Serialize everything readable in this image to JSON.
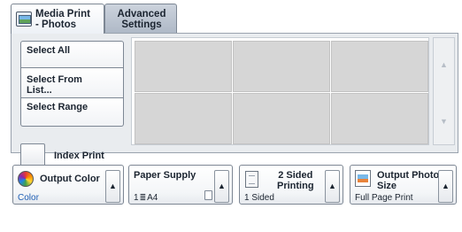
{
  "tabs": [
    {
      "label": "Media Print - Photos",
      "line1": "Media Print",
      "line2": "- Photos",
      "active": true
    },
    {
      "label": "Advanced Settings",
      "line1": "Advanced",
      "line2": "Settings",
      "active": false
    }
  ],
  "selection": {
    "select_all": "Select All",
    "select_from_list_1": "Select From",
    "select_from_list_2": "List...",
    "select_range": "Select Range",
    "index_print": "Index Print"
  },
  "thumbnails": {
    "rows": 2,
    "cols": 3
  },
  "bottom": {
    "output_color": {
      "title": "Output Color",
      "value": "Color",
      "value_color": "#1f5fb5"
    },
    "paper_supply": {
      "title": "Paper Supply",
      "value": "A4",
      "tray": "1"
    },
    "two_sided": {
      "title1": "2 Sided",
      "title2": "Printing",
      "value": "1 Sided"
    },
    "output_photo_size": {
      "title1": "Output Photo",
      "title2": "Size",
      "value": "Full Page Print"
    }
  },
  "icons": {
    "tab_media": "photo-print-icon",
    "scroll_up": "arrow-up-icon",
    "scroll_down": "arrow-down-icon",
    "expand": "arrow-up-icon"
  },
  "colors": {
    "accent": "#1f5fb5",
    "panel": "#e9ecef",
    "thumb": "#d6d6d6"
  }
}
